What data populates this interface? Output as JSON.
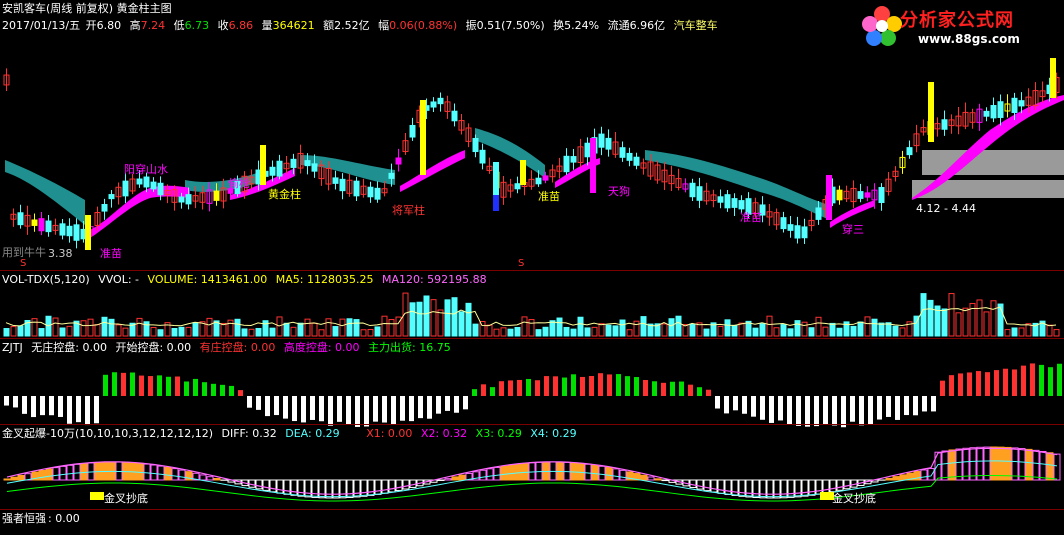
{
  "header": {
    "title": "安凯客车(周线 前复权) 黄金柱主图",
    "date": "2017/01/13/五",
    "open_label": "开",
    "open": "6.80",
    "high_label": "高",
    "high": "7.24",
    "low_label": "低",
    "low": "6.73",
    "close_label": "收",
    "close": "6.86",
    "vol_label": "量",
    "vol": "364621",
    "amount_label": "额",
    "amount": "2.52亿",
    "change_label": "幅",
    "change": "0.06(0.88%)",
    "amp_label": "振",
    "amp": "0.51(7.50%)",
    "turnover_label": "换",
    "turnover": "5.24%",
    "float_label": "流通",
    "float": "6.96亿",
    "sector": "汽车整车"
  },
  "logo": {
    "text": "分析家公式网",
    "url": "www.88gs.com"
  },
  "main_chart": {
    "annotations": {
      "golden_pillar": "黄金柱",
      "general_pillar": "将军柱",
      "zhunmiao_1": "准苗",
      "zhunmiao_2": "准苗",
      "zhunmiao_3": "准苗",
      "tiangou": "天狗",
      "chuansan": "穿三",
      "huaishan": "阳穿山水",
      "touqiang": "偷枪",
      "range": "4.12 - 4.44",
      "bottom_left": "用到牛牛",
      "bottom_left_val": "3.38",
      "signal_s1": "S",
      "signal_s2": "S"
    }
  },
  "vol_panel": {
    "name": "VOL-TDX(5,120)",
    "vvol": "VVOL: -",
    "volume": "VOLUME: 1413461.00",
    "ma5": "MA5: 1128035.25",
    "ma120": "MA120: 592195.88"
  },
  "zjtj_panel": {
    "name": "ZJTJ",
    "wuzhuang": "无庄控盘: 0.00",
    "kaishi": "开始控盘: 0.00",
    "youzhuang": "有庄控盘: 0.00",
    "gaodu": "高度控盘: 0.00",
    "zhuli": "主力出货: 16.75"
  },
  "jc_panel": {
    "name": "金叉起爆-10万(10,10,10,3,12,12,12,12)",
    "diff": "DIFF: 0.32",
    "dea": "DEA: 0.29",
    "x1": "X1: 0.00",
    "x2": "X2: 0.32",
    "x3": "X3: 0.29",
    "x4": "X4: 0.29",
    "buy_label_1": "金叉抄底",
    "buy_label_2": "金叉抄底"
  },
  "strong_panel": {
    "name": "强者恒强",
    "value": ": 0.00"
  },
  "colors": {
    "up": "#ff3232",
    "down": "#54ffff",
    "gold": "#ffff00",
    "magenta": "#ff00ff",
    "teal": "#1f8f8f",
    "grey": "#9a9a9a"
  }
}
